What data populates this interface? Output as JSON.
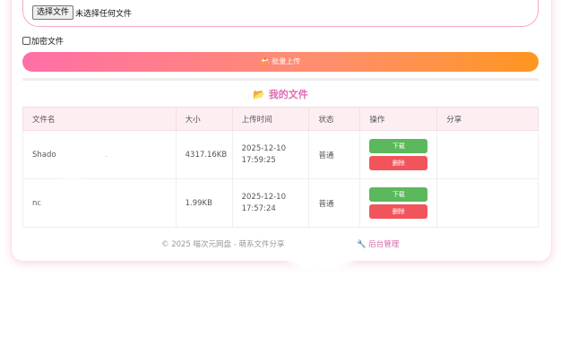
{
  "upload": {
    "choose_label": "选择文件",
    "no_file_text": "未选择任何文件",
    "encrypt_label": "加密文件",
    "upload_label": "批量上传",
    "upload_icon": "cake-icon"
  },
  "files_section": {
    "title": "我的文件",
    "title_icon": "open-folder-icon",
    "columns": [
      "文件名",
      "大小",
      "上传时间",
      "状态",
      "操作",
      "分享"
    ],
    "rows": [
      {
        "name": "Shado",
        "name_tail": "..",
        "size": "4317.16KB",
        "date": "2025-12-10",
        "time": "17:59:25",
        "status": "普通",
        "download": "下载",
        "delete": "删除",
        "share": ""
      },
      {
        "name": "nc",
        "name_tail": "",
        "size": "1.99KB",
        "date": "2025-12-10",
        "time": "17:57:24",
        "status": "普通",
        "download": "下载",
        "delete": "删除",
        "share": ""
      }
    ]
  },
  "footer": {
    "copyright": "© 2025 喵次元网盘 - 萌系文件分享",
    "admin_icon": "wrench-icon",
    "admin_label": "后台管理"
  },
  "colors": {
    "accent": "#e06bb2",
    "gradient_start": "#ff6fa7",
    "gradient_end": "#ff9620",
    "download": "#5cb85c",
    "delete": "#f2545b"
  }
}
